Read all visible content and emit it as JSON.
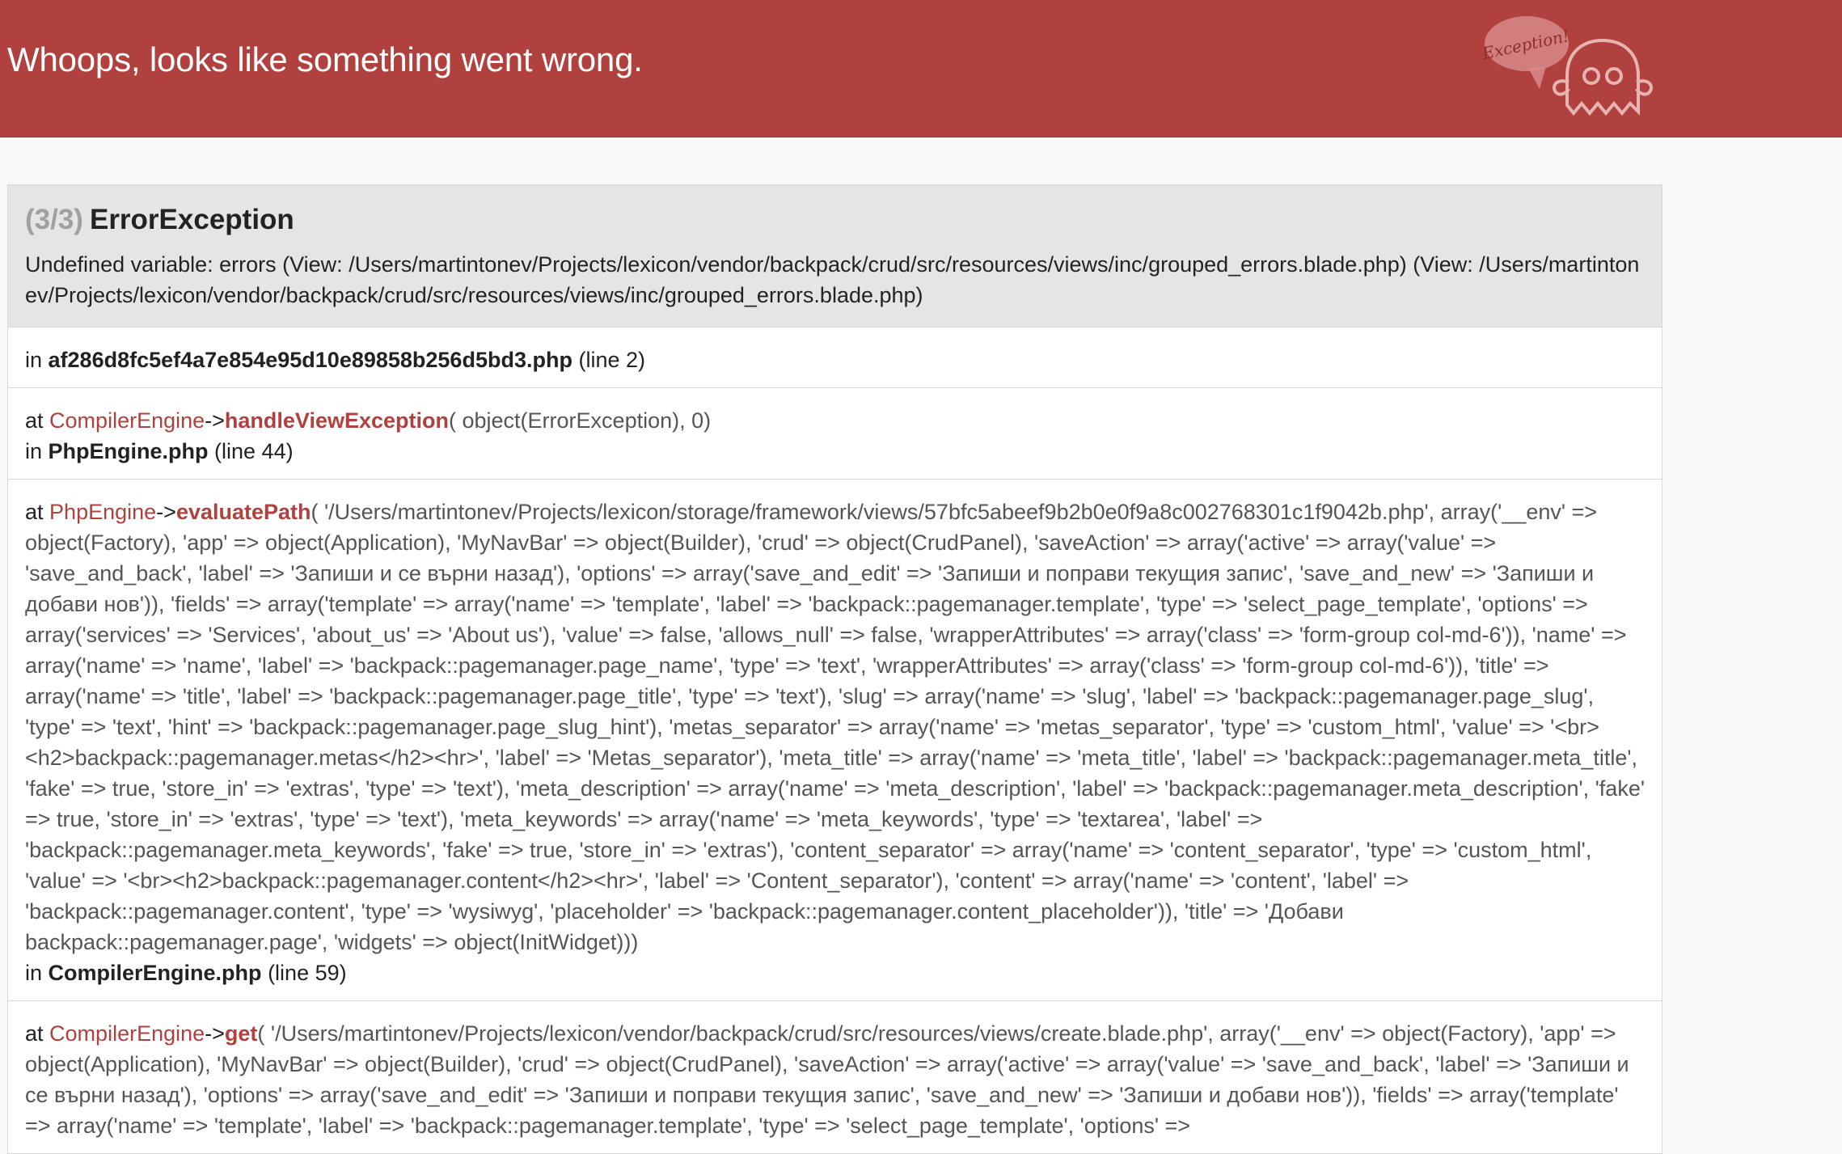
{
  "header": {
    "title": "Whoops, looks like something went wrong.",
    "badge_text": "Exception!",
    "logo_icon": "ghost-icon",
    "background_color": "#b0413e"
  },
  "exception": {
    "count": "(3/3)",
    "type": "ErrorException",
    "message": "Undefined variable: errors (View: /Users/martintonev/Projects/lexicon/vendor/backpack/crud/src/resources/views/inc/grouped_errors.blade.php) (View: /Users/martintonev/Projects/lexicon/vendor/backpack/crud/src/resources/views/inc/grouped_errors.blade.php)"
  },
  "trace": {
    "first": {
      "in_label": "in",
      "file": "af286d8fc5ef4a7e854e95d10e89858b256d5bd3.php",
      "line": "(line 2)"
    },
    "frames": [
      {
        "at_label": "at",
        "class": "CompilerEngine",
        "arrow": "->",
        "function": "handleViewException",
        "args": "( object(ErrorException), 0)",
        "in_label": "in",
        "file": "PhpEngine.php",
        "line": "(line 44)"
      },
      {
        "at_label": "at",
        "class": "PhpEngine",
        "arrow": "->",
        "function": "evaluatePath",
        "args": "( '/Users/martintonev/Projects/lexicon/storage/framework/views/57bfc5abeef9b2b0e0f9a8c002768301c1f9042b.php', array('__env' => object(Factory), 'app' => object(Application), 'MyNavBar' => object(Builder), 'crud' => object(CrudPanel), 'saveAction' => array('active' => array('value' => 'save_and_back', 'label' => 'Запиши и се върни назад'), 'options' => array('save_and_edit' => 'Запиши и поправи текущия запис', 'save_and_new' => 'Запиши и добави нов')), 'fields' => array('template' => array('name' => 'template', 'label' => 'backpack::pagemanager.template', 'type' => 'select_page_template', 'options' => array('services' => 'Services', 'about_us' => 'About us'), 'value' => false, 'allows_null' => false, 'wrapperAttributes' => array('class' => 'form-group col-md-6')), 'name' => array('name' => 'name', 'label' => 'backpack::pagemanager.page_name', 'type' => 'text', 'wrapperAttributes' => array('class' => 'form-group col-md-6')), 'title' => array('name' => 'title', 'label' => 'backpack::pagemanager.page_title', 'type' => 'text'), 'slug' => array('name' => 'slug', 'label' => 'backpack::pagemanager.page_slug', 'type' => 'text', 'hint' => 'backpack::pagemanager.page_slug_hint'), 'metas_separator' => array('name' => 'metas_separator', 'type' => 'custom_html', 'value' => '<br><h2>backpack::pagemanager.metas</h2><hr>', 'label' => 'Metas_separator'), 'meta_title' => array('name' => 'meta_title', 'label' => 'backpack::pagemanager.meta_title', 'fake' => true, 'store_in' => 'extras', 'type' => 'text'), 'meta_description' => array('name' => 'meta_description', 'label' => 'backpack::pagemanager.meta_description', 'fake' => true, 'store_in' => 'extras', 'type' => 'text'), 'meta_keywords' => array('name' => 'meta_keywords', 'type' => 'textarea', 'label' => 'backpack::pagemanager.meta_keywords', 'fake' => true, 'store_in' => 'extras'), 'content_separator' => array('name' => 'content_separator', 'type' => 'custom_html', 'value' => '<br><h2>backpack::pagemanager.content</h2><hr>', 'label' => 'Content_separator'), 'content' => array('name' => 'content', 'label' => 'backpack::pagemanager.content', 'type' => 'wysiwyg', 'placeholder' => 'backpack::pagemanager.content_placeholder')), 'title' => 'Добави backpack::pagemanager.page', 'widgets' => object(InitWidget)))",
        "in_label": "in",
        "file": "CompilerEngine.php",
        "line": "(line 59)"
      },
      {
        "at_label": "at",
        "class": "CompilerEngine",
        "arrow": "->",
        "function": "get",
        "args": "( '/Users/martintonev/Projects/lexicon/vendor/backpack/crud/src/resources/views/create.blade.php', array('__env' => object(Factory), 'app' => object(Application), 'MyNavBar' => object(Builder), 'crud' => object(CrudPanel), 'saveAction' => array('active' => array('value' => 'save_and_back', 'label' => 'Запиши и се върни назад'), 'options' => array('save_and_edit' => 'Запиши и поправи текущия запис', 'save_and_new' => 'Запиши и добави нов')), 'fields' => array('template' => array('name' => 'template', 'label' => 'backpack::pagemanager.template', 'type' => 'select_page_template', 'options' =>"
      }
    ]
  }
}
